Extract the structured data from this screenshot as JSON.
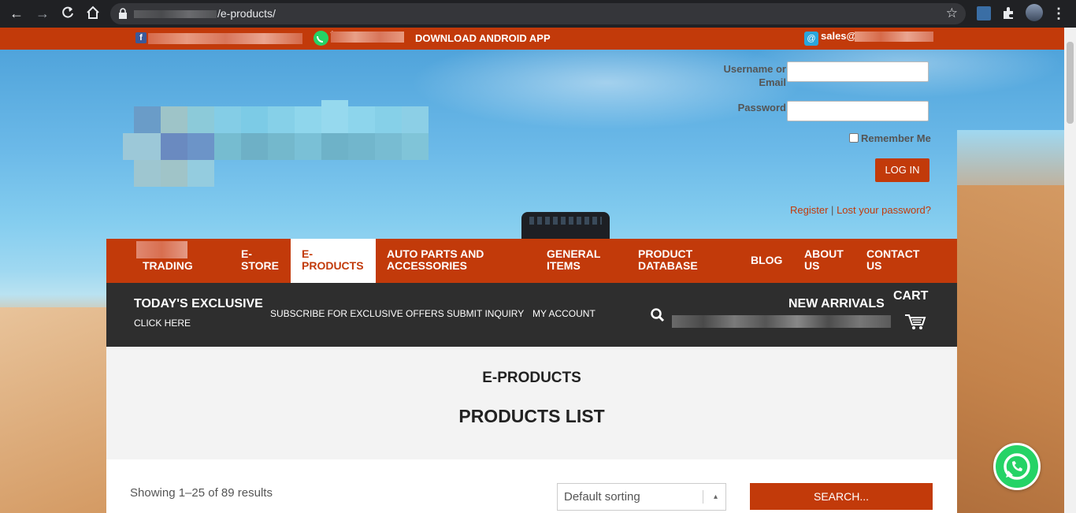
{
  "browser": {
    "url_path": "/e-products/"
  },
  "topbar": {
    "facebook_prefix": "f",
    "whatsapp_prefix": "+",
    "download_app": "DOWNLOAD ANDROID APP",
    "email_prefix": "sales@"
  },
  "login": {
    "username_label_line1": "Username or",
    "username_label_line2": "Email",
    "password_label": "Password",
    "remember_label": "Remember Me",
    "login_button": "LOG IN",
    "register_link": "Register",
    "separator": "|",
    "lost_password_link": "Lost your password?"
  },
  "mainnav": {
    "items": [
      {
        "line1": "",
        "line2": "TRADING"
      },
      {
        "line1": "E-",
        "line2": "STORE"
      },
      {
        "line1": "E-",
        "line2": "PRODUCTS"
      },
      {
        "line1": "AUTO PARTS AND",
        "line2": "ACCESSORIES"
      },
      {
        "line1": "GENERAL",
        "line2": "ITEMS"
      },
      {
        "line1": "PRODUCT",
        "line2": "DATABASE"
      },
      {
        "line1": "BLOG",
        "line2": ""
      },
      {
        "line1": "ABOUT",
        "line2": "US"
      },
      {
        "line1": "CONTACT",
        "line2": "US"
      }
    ],
    "active_index": 2
  },
  "subbar": {
    "todays_exclusive": "TODAY'S EXCLUSIVE",
    "click_here": "CLICK HERE",
    "subscribe": "SUBSCRIBE FOR EXCLUSIVE OFFERS",
    "submit_inquiry": "SUBMIT INQUIRY",
    "my_account": "MY ACCOUNT",
    "new_arrivals": "NEW ARRIVALS",
    "cart": "CART"
  },
  "content": {
    "category": "E-PRODUCTS",
    "title": "PRODUCTS LIST",
    "showing": "Showing 1–25 of 89 results",
    "sort_selected": "Default sorting",
    "search_button": "SEARCH..."
  },
  "colors": {
    "brand": "#c23a0a",
    "dark_bar": "#2e2e2e",
    "whatsapp": "#25d366"
  },
  "icons": [
    "back-arrow-icon",
    "forward-arrow-icon",
    "reload-icon",
    "home-icon",
    "lock-icon",
    "star-icon",
    "puzzle-icon",
    "menu-icon",
    "facebook-icon",
    "whatsapp-icon",
    "at-icon",
    "search-icon",
    "cart-icon"
  ]
}
